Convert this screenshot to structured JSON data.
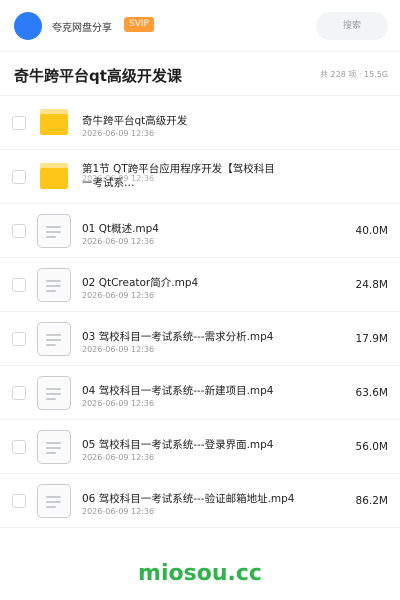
{
  "header": {
    "username": "夸克网盘分享",
    "vip_badge": "SVIP",
    "search_placeholder": "搜索",
    "accent_color": "#2b7cf6",
    "vip_color": "#ff9c38"
  },
  "title_bar": {
    "title": "奇牛跨平台qt高级开发课",
    "meta": "共 228 项 · 15.5G"
  },
  "items": [
    {
      "type": "folder",
      "name": "奇牛跨平台qt高级开发",
      "date": "2026-06-09 12:36",
      "size": ""
    },
    {
      "type": "folder",
      "name": "第1节 QT跨平台应用程序开发【驾校科目一考试系…",
      "date": "2026-06-09 12:36",
      "size": ""
    },
    {
      "type": "file",
      "name": "01 Qt概述.mp4",
      "date": "2026-06-09 12:36",
      "size": "40.0M"
    },
    {
      "type": "file",
      "name": "02 QtCreator简介.mp4",
      "date": "2026-06-09 12:36",
      "size": "24.8M"
    },
    {
      "type": "file",
      "name": "03 驾校科目一考试系统---需求分析.mp4",
      "date": "2026-06-09 12:36",
      "size": "17.9M"
    },
    {
      "type": "file",
      "name": "04 驾校科目一考试系统---新建项目.mp4",
      "date": "2026-06-09 12:36",
      "size": "63.6M"
    },
    {
      "type": "file",
      "name": "05 驾校科目一考试系统---登录界面.mp4",
      "date": "2026-06-09 12:36",
      "size": "56.0M"
    },
    {
      "type": "file",
      "name": "06 驾校科目一考试系统---验证邮箱地址.mp4",
      "date": "2026-06-09 12:36",
      "size": "86.2M"
    }
  ],
  "watermark": "miosou.cc"
}
